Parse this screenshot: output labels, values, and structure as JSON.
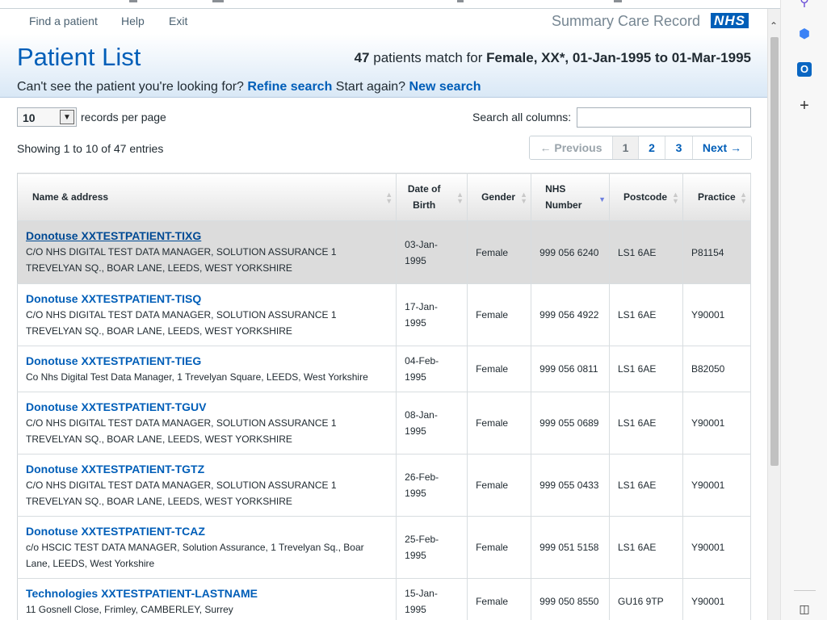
{
  "nav": {
    "links": [
      "Find a patient",
      "Help",
      "Exit"
    ],
    "brand": "Summary Care Record",
    "logo_text": "NHS"
  },
  "header": {
    "title": "Patient List",
    "match_count": "47",
    "match_text": "patients match for",
    "match_criteria": "Female, XX*, 01-Jan-1995 to 01-Mar-1995",
    "cant_see": "Can't see the patient you're looking for?",
    "refine_link": "Refine search",
    "start_again": "Start again?",
    "new_search_link": "New search"
  },
  "controls": {
    "records_per_page_value": "10",
    "records_per_page_label": "records per page",
    "search_label": "Search all columns:",
    "search_value": "",
    "showing": "Showing 1 to 10 of 47 entries",
    "pager": {
      "previous": "← Previous",
      "pages": [
        "1",
        "2",
        "3"
      ],
      "current_page": "1",
      "next": "Next →"
    }
  },
  "table": {
    "columns": [
      "Name & address",
      "Date of Birth",
      "Gender",
      "NHS Number",
      "Postcode",
      "Practice"
    ],
    "sorted_column": "NHS Number",
    "sort_direction": "descending",
    "rows": [
      {
        "name": "Donotuse XXTESTPATIENT-TIXG",
        "address": "C/O NHS DIGITAL TEST DATA MANAGER, SOLUTION ASSURANCE 1 TREVELYAN SQ., BOAR LANE, LEEDS, WEST YORKSHIRE",
        "dob": "03-Jan-1995",
        "gender": "Female",
        "nhs": "999 056 6240",
        "postcode": "LS1 6AE",
        "practice": "P81154"
      },
      {
        "name": "Donotuse XXTESTPATIENT-TISQ",
        "address": "C/O NHS DIGITAL TEST DATA MANAGER, SOLUTION ASSURANCE 1 TREVELYAN SQ., BOAR LANE, LEEDS, WEST YORKSHIRE",
        "dob": "17-Jan-1995",
        "gender": "Female",
        "nhs": "999 056 4922",
        "postcode": "LS1 6AE",
        "practice": "Y90001"
      },
      {
        "name": "Donotuse XXTESTPATIENT-TIEG",
        "address": "Co Nhs Digital Test Data Manager, 1 Trevelyan Square, LEEDS, West Yorkshire",
        "dob": "04-Feb-1995",
        "gender": "Female",
        "nhs": "999 056 0811",
        "postcode": "LS1 6AE",
        "practice": "B82050"
      },
      {
        "name": "Donotuse XXTESTPATIENT-TGUV",
        "address": "C/O NHS DIGITAL TEST DATA MANAGER, SOLUTION ASSURANCE 1 TREVELYAN SQ., BOAR LANE, LEEDS, WEST YORKSHIRE",
        "dob": "08-Jan-1995",
        "gender": "Female",
        "nhs": "999 055 0689",
        "postcode": "LS1 6AE",
        "practice": "Y90001"
      },
      {
        "name": "Donotuse XXTESTPATIENT-TGTZ",
        "address": "C/O NHS DIGITAL TEST DATA MANAGER, SOLUTION ASSURANCE 1 TREVELYAN SQ., BOAR LANE, LEEDS, WEST YORKSHIRE",
        "dob": "26-Feb-1995",
        "gender": "Female",
        "nhs": "999 055 0433",
        "postcode": "LS1 6AE",
        "practice": "Y90001"
      },
      {
        "name": "Donotuse XXTESTPATIENT-TCAZ",
        "address": "c/o HSCIC TEST DATA MANAGER, Solution Assurance, 1 Trevelyan Sq., Boar Lane, LEEDS, West Yorkshire",
        "dob": "25-Feb-1995",
        "gender": "Female",
        "nhs": "999 051 5158",
        "postcode": "LS1 6AE",
        "practice": "Y90001"
      },
      {
        "name": "Technologies XXTESTPATIENT-LASTNAME",
        "address": "11 Gosnell Close, Frimley, CAMBERLEY, Surrey",
        "dob": "15-Jan-1995",
        "gender": "Female",
        "nhs": "999 050 8550",
        "postcode": "GU16 9TP",
        "practice": "Y90001"
      }
    ]
  },
  "browser_sidebar": {
    "icons": [
      "search-icon",
      "copilot-icon",
      "outlook-icon",
      "add-icon",
      "sidebar-toggle-icon"
    ]
  },
  "colors": {
    "nhs_blue": "#005eb8",
    "link": "#005eb8",
    "highlight_row": "#dcdcdc"
  }
}
